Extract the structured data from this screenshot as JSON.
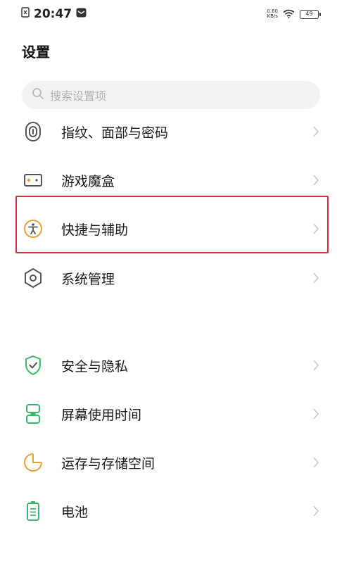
{
  "status_bar": {
    "time": "20:47",
    "net_speed_value": "0.60",
    "net_speed_unit": "KB/s",
    "battery": "49"
  },
  "header": {
    "title": "设置"
  },
  "search": {
    "placeholder": "搜索设置项"
  },
  "colors": {
    "accent_highlight": "#d9303a",
    "icon_gray": "#555555",
    "icon_green": "#3bb86b",
    "icon_orange": "#e8a23a"
  },
  "settings_items": [
    {
      "label": "指纹、面部与密码",
      "icon": "fingerprint-icon"
    },
    {
      "label": "游戏魔盒",
      "icon": "game-box-icon"
    },
    {
      "label": "快捷与辅助",
      "icon": "accessibility-icon",
      "highlighted": true
    },
    {
      "label": "系统管理",
      "icon": "system-hexagon-icon"
    },
    {
      "label": "安全与隐私",
      "icon": "shield-check-icon"
    },
    {
      "label": "屏幕使用时间",
      "icon": "hourglass-icon"
    },
    {
      "label": "运存与存储空间",
      "icon": "storage-pie-icon"
    },
    {
      "label": "电池",
      "icon": "battery-icon"
    }
  ]
}
